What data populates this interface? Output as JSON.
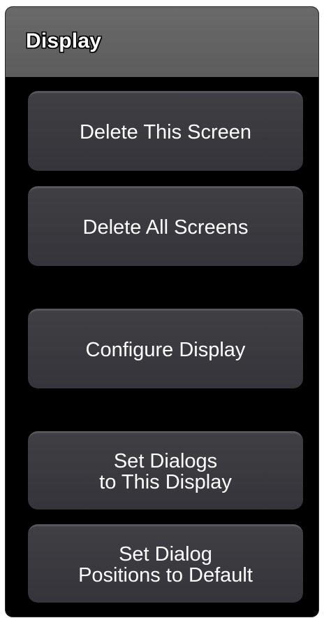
{
  "panel": {
    "title": "Display"
  },
  "buttons": {
    "delete_this_screen": "Delete This Screen",
    "delete_all_screens": "Delete All Screens",
    "configure_display": "Configure Display",
    "set_dialogs_to_this_display": "Set Dialogs\nto This Display",
    "set_dialog_positions_default": "Set Dialog\nPositions to Default"
  },
  "colors": {
    "header_bg": "#666666",
    "panel_bg": "#000000",
    "button_bg": "#3b3b40",
    "text": "#ffffff"
  }
}
